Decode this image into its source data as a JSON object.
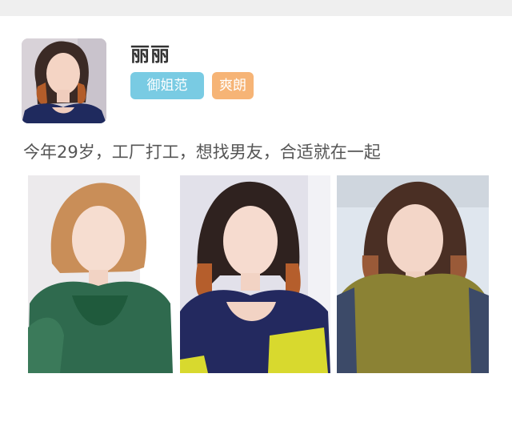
{
  "profile": {
    "name": "丽丽",
    "tags": [
      "御姐范",
      "爽朗"
    ],
    "description": "今年29岁，工厂打工，想找男友，合适就在一起"
  },
  "colors": {
    "tag_primary": "#79cbe3",
    "tag_secondary": "#f6b476",
    "name_text": "#333333",
    "desc_text": "#555555"
  },
  "photos": [
    {
      "icon": "portrait-photo",
      "shirt": "green"
    },
    {
      "icon": "portrait-photo",
      "shirt": "navy"
    },
    {
      "icon": "portrait-photo",
      "shirt": "olive"
    }
  ]
}
